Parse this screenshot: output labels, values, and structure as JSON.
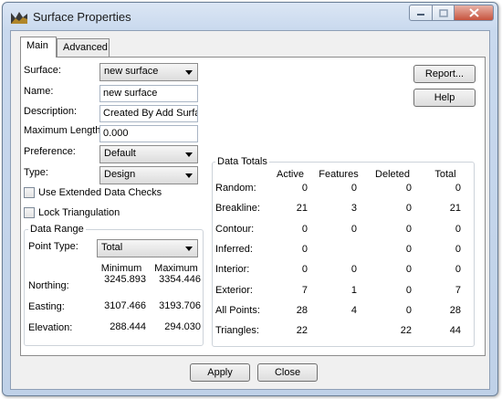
{
  "window": {
    "title": "Surface Properties"
  },
  "tabs": [
    {
      "label": "Main"
    },
    {
      "label": "Advanced"
    }
  ],
  "main": {
    "surface_label": "Surface:",
    "surface_value": "new surface",
    "name_label": "Name:",
    "name_value": "new surface",
    "description_label": "Description:",
    "description_value": "Created By Add Surface",
    "maxlen_label": "Maximum Length:",
    "maxlen_value": "0.000",
    "preference_label": "Preference:",
    "preference_value": "Default",
    "type_label": "Type:",
    "type_value": "Design",
    "extended_checks_label": "Use Extended Data Checks",
    "lock_triangulation_label": "Lock Triangulation"
  },
  "data_range": {
    "title": "Data Range",
    "point_type_label": "Point Type:",
    "point_type_value": "Total",
    "headers": [
      "Minimum",
      "Maximum"
    ],
    "rows": [
      {
        "label": "Northing:",
        "min": "3245.893",
        "max": "3354.446"
      },
      {
        "label": "Easting:",
        "min": "3107.466",
        "max": "3193.706"
      },
      {
        "label": "Elevation:",
        "min": "288.444",
        "max": "294.030"
      }
    ]
  },
  "data_totals": {
    "title": "Data Totals",
    "headers": [
      "Active",
      "Features",
      "Deleted",
      "Total"
    ],
    "rows": [
      {
        "label": "Random:",
        "active": "0",
        "features": "0",
        "deleted": "0",
        "total": "0"
      },
      {
        "label": "Breakline:",
        "active": "21",
        "features": "3",
        "deleted": "0",
        "total": "21"
      },
      {
        "label": "Contour:",
        "active": "0",
        "features": "0",
        "deleted": "0",
        "total": "0"
      },
      {
        "label": "Inferred:",
        "active": "0",
        "features": "",
        "deleted": "0",
        "total": "0"
      },
      {
        "label": "Interior:",
        "active": "0",
        "features": "0",
        "deleted": "0",
        "total": "0"
      },
      {
        "label": "Exterior:",
        "active": "7",
        "features": "1",
        "deleted": "0",
        "total": "7"
      },
      {
        "label": "All Points:",
        "active": "28",
        "features": "4",
        "deleted": "0",
        "total": "28"
      },
      {
        "label": "Triangles:",
        "active": "22",
        "features": "",
        "deleted": "22",
        "total": "44"
      }
    ]
  },
  "buttons": {
    "report": "Report...",
    "help": "Help",
    "apply": "Apply",
    "close": "Close"
  },
  "colors": {
    "title_bar": "#c9d9ee",
    "close_button": "#c7533e",
    "panel_bg": "#ffffff"
  }
}
